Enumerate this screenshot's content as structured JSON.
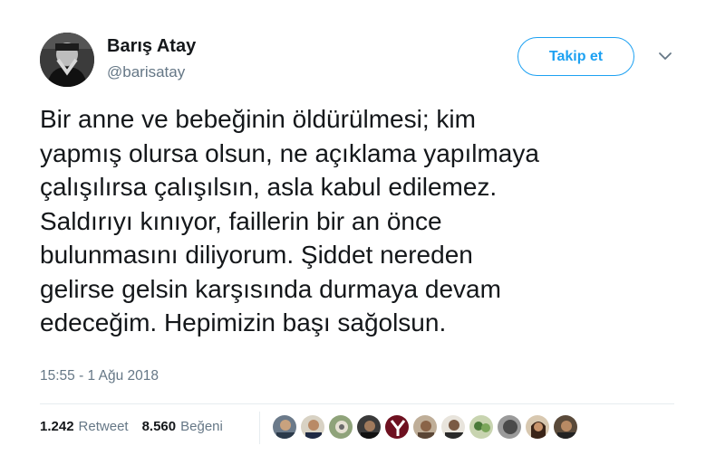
{
  "author": {
    "name": "Barış Atay",
    "handle": "@barisatay"
  },
  "follow_button": {
    "label": "Takip et"
  },
  "menu_icon": "chevron-down-icon",
  "tweet": {
    "text": "Bir anne ve bebeğinin öldürülmesi; kim\nyapmış olursa olsun, ne açıklama yapılmaya\nçalışılırsa çalışılsın, asla kabul edilemez.\nSaldırıyı kınıyor, faillerin bir an önce\nbulunmasını diliyorum. Şiddet nereden\ngelirse gelsin karşısında durmaya devam\nedeceğim. Hepimizin başı sağolsun.",
    "timestamp": "15:55 - 1 Ağu 2018"
  },
  "stats": {
    "retweet_count": "1.242",
    "retweet_label": "Retweet",
    "like_count": "8.560",
    "like_label": "Beğeni"
  },
  "colors": {
    "accent": "#1da1f2",
    "text": "#14171a",
    "muted": "#657786",
    "divider": "#e6ecf0"
  }
}
